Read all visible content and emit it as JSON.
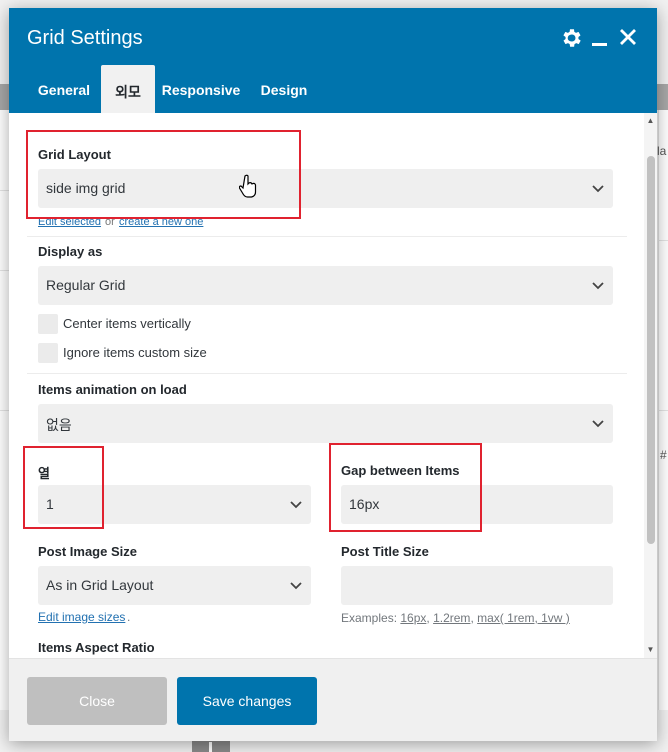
{
  "modal": {
    "title": "Grid Settings",
    "tabs": [
      {
        "label": "General",
        "active": false
      },
      {
        "label": "외모",
        "active": true
      },
      {
        "label": "Responsive",
        "active": false
      },
      {
        "label": "Design",
        "active": false
      }
    ],
    "header_icons": [
      "gear-icon",
      "minimize-icon",
      "close-icon"
    ]
  },
  "background": {
    "edge_text_right_1": "la",
    "edge_text_right_2": "#"
  },
  "form": {
    "grid_layout": {
      "label": "Grid Layout",
      "value": "side img grid",
      "link_edit": "Edit selected",
      "link_or": "or",
      "link_create": "create a new one"
    },
    "display_as": {
      "label": "Display as",
      "value": "Regular Grid"
    },
    "center_vertically": {
      "label": "Center items vertically",
      "checked": false
    },
    "ignore_custom_size": {
      "label": "Ignore items custom size",
      "checked": false
    },
    "animation": {
      "label": "Items animation on load",
      "value": "없음"
    },
    "columns": {
      "label": "열",
      "value": "1"
    },
    "gap": {
      "label": "Gap between Items",
      "value": "16px"
    },
    "post_image_size": {
      "label": "Post Image Size",
      "value": "As in Grid Layout",
      "link": "Edit image sizes",
      "link_suffix": "."
    },
    "post_title_size": {
      "label": "Post Title Size",
      "value": "",
      "hint_prefix": "Examples:",
      "hint_1": "16px",
      "hint_2": "1.2rem",
      "hint_3": "max( 1rem, 1vw )"
    },
    "aspect_ratio": {
      "label": "Items Aspect Ratio"
    }
  },
  "footer": {
    "close_label": "Close",
    "save_label": "Save changes"
  },
  "colors": {
    "header": "#0074ad",
    "highlight": "#e0222f",
    "save_button": "#0074ad",
    "close_button": "#bfbfbf"
  }
}
